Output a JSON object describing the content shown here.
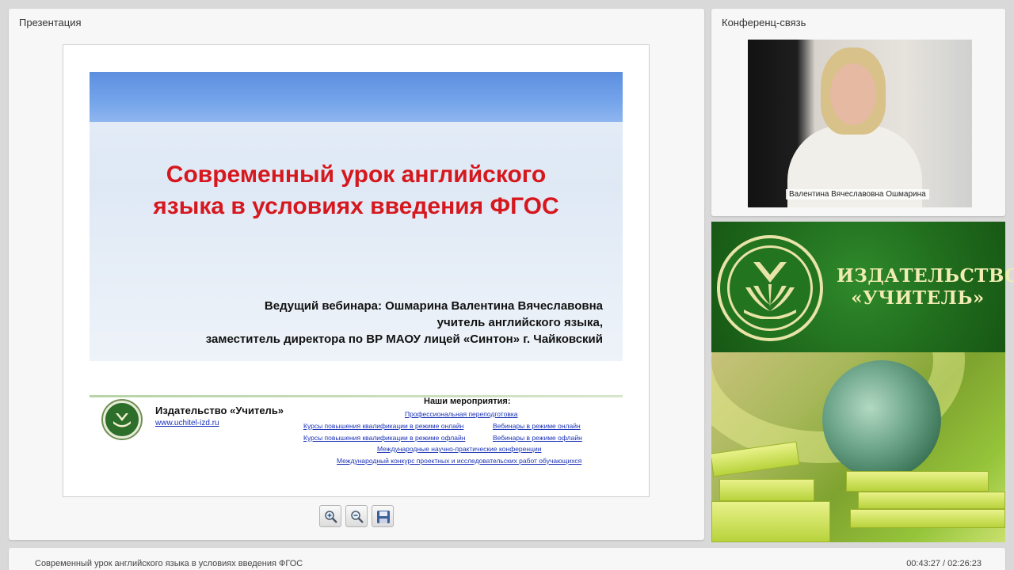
{
  "presentation": {
    "title": "Презентация",
    "slide": {
      "title_line1": "Современный урок английского",
      "title_line2": "языка в условиях введения ФГОС",
      "host_line1": "Ведущий вебинара:  Ошмарина Валентина Вячеславовна",
      "host_line2": "учитель английского языка,",
      "host_line3": "заместитель директора по ВР МАОУ лицей «Синтон» г. Чайковский",
      "publisher_name": "Издательство «Учитель»",
      "publisher_url": "www.uchitel-izd.ru",
      "events_heading": "Наши мероприятия:",
      "events": {
        "retraining": "Профессиональная переподготовка",
        "courses_online": "Курсы повышения квалификации в режиме онлайн",
        "webinars_online": "Вебинары в режиме онлайн",
        "courses_offline": "Курсы повышения квалификации в режиме офлайн",
        "webinars_offline": "Вебинары в режиме офлайн",
        "conferences": "Международные научно-практические конференции",
        "contest": "Международный конкурс проектных и исследовательских работ обучающихся"
      }
    },
    "toolbar": {
      "zoom_in_icon": "zoom-in-icon",
      "zoom_out_icon": "zoom-out-icon",
      "save_icon": "floppy-disk-icon"
    }
  },
  "conference": {
    "title": "Конференц-связь",
    "participant_name": "Валентина Вячеславовна Ошмарина"
  },
  "ad": {
    "publisher_line1": "ИЗДАТЕЛЬСТВО",
    "publisher_line2": "«УЧИТЕЛЬ»"
  },
  "footer": {
    "webinar_title": "Современный урок английского языка в условиях введения ФГОС",
    "time": "00:43:27 / 02:26:23"
  },
  "colors": {
    "slide_title": "#d6181e",
    "link": "#1b33b8",
    "publisher_green": "#1f6a1c",
    "publisher_gold": "#f1ecb2"
  }
}
